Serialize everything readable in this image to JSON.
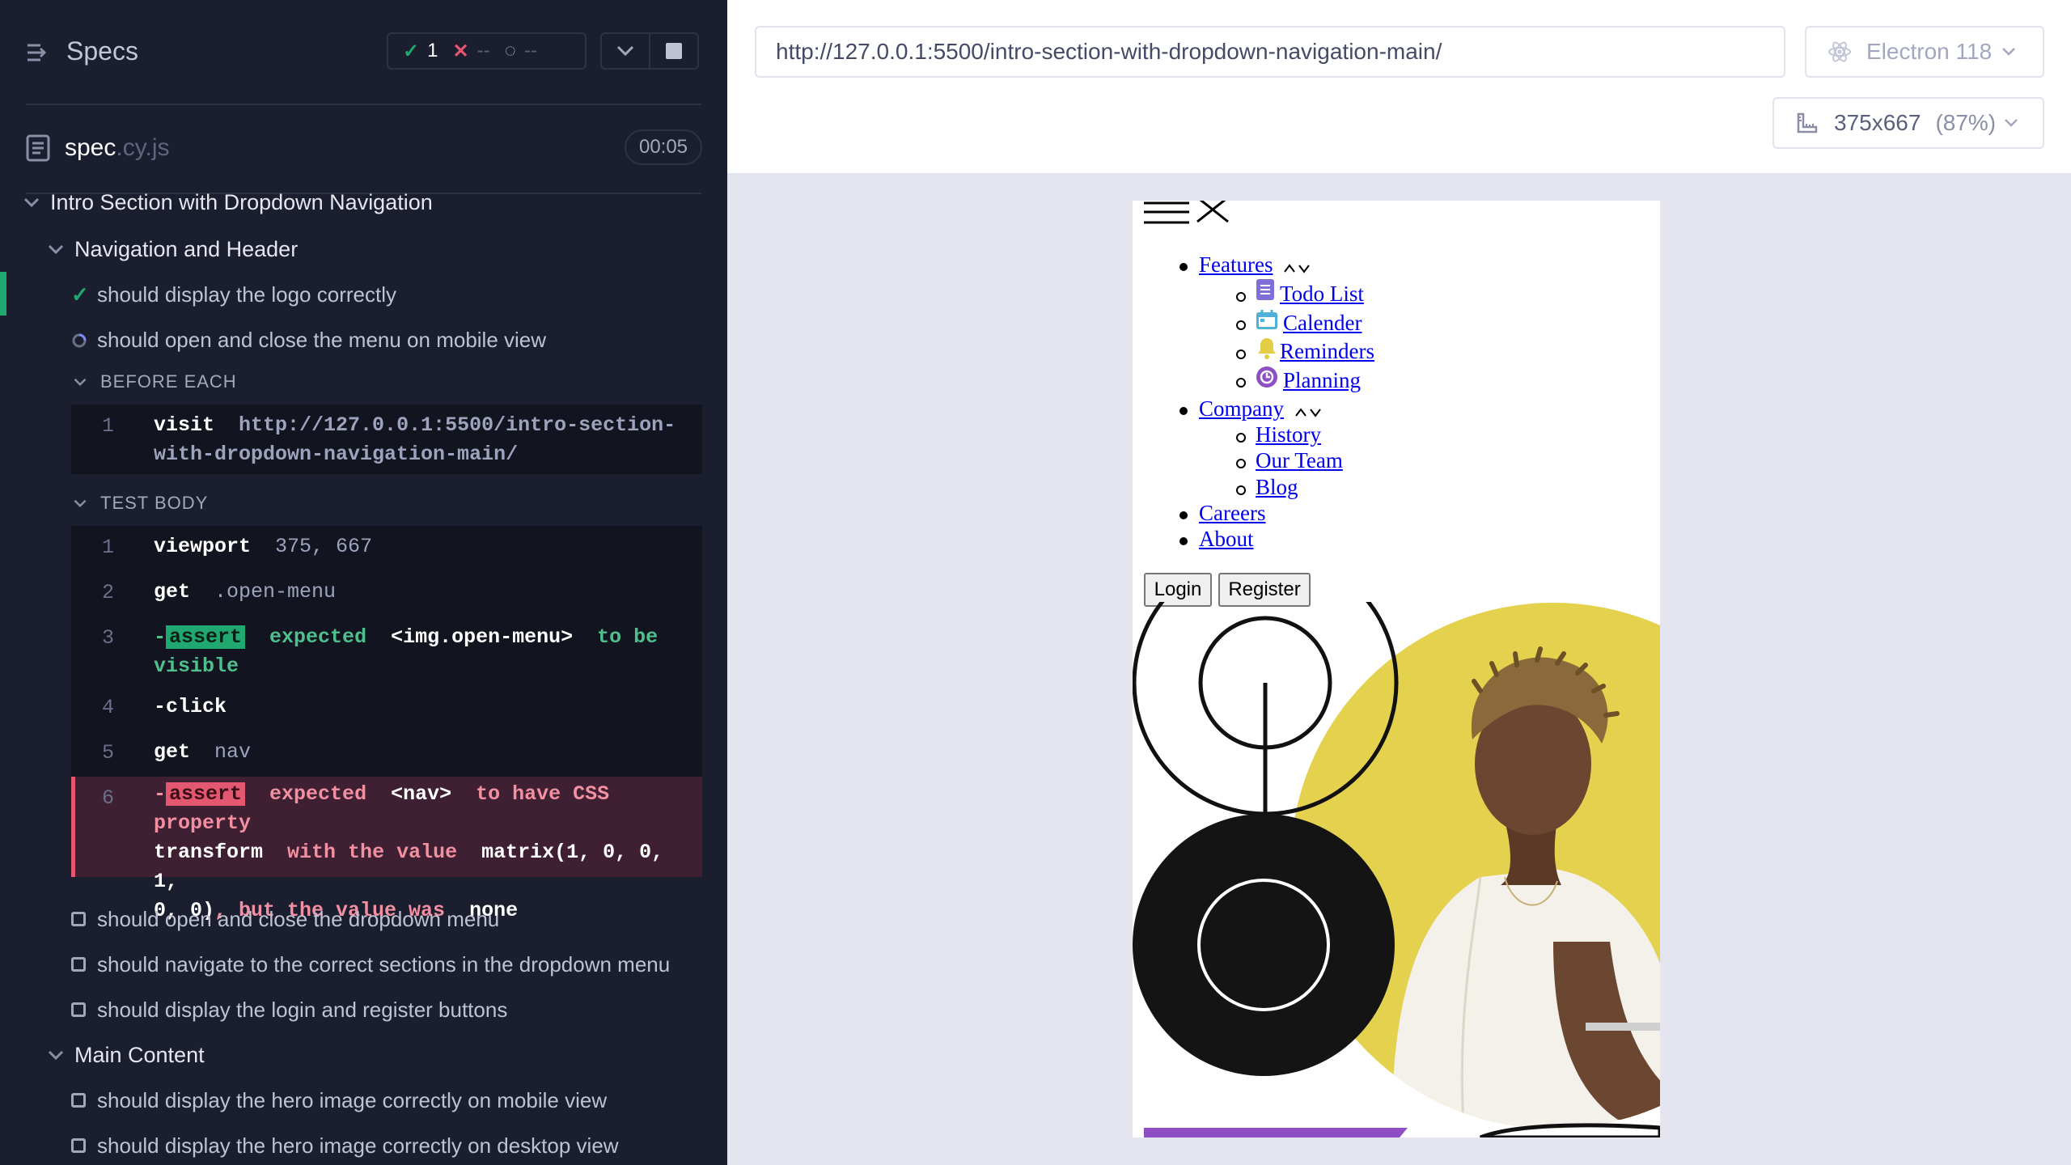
{
  "reporter": {
    "title": "Specs",
    "stats": {
      "passed": "1",
      "failed": "--",
      "pending": "--"
    },
    "spec": {
      "name": "spec",
      "ext": ".cy.js",
      "duration": "00:05"
    },
    "suite": "Intro Section with Dropdown Navigation",
    "groups": {
      "nav_header": "Navigation and Header",
      "main_content": "Main Content"
    },
    "tests": {
      "t1": "should display the logo correctly",
      "t2": "should open and close the menu on mobile view",
      "t3": "should open and close the dropdown menu",
      "t4": "should navigate to the correct sections in the dropdown menu",
      "t5": "should display the login and register buttons",
      "t6": "should display the hero image correctly on mobile view",
      "t7": "should display the hero image correctly on desktop view"
    },
    "hooks": {
      "before_each": "BEFORE EACH",
      "test_body": "TEST BODY"
    },
    "before_each_cmds": [
      {
        "n": "1",
        "name": "visit",
        "arg": "http://127.0.0.1:5500/intro-section-",
        "arg2": "with-dropdown-navigation-main/"
      }
    ],
    "body_cmds": {
      "c1": {
        "n": "1",
        "name": "viewport",
        "arg": "375, 667"
      },
      "c2": {
        "n": "2",
        "name": "get",
        "arg": ".open-menu"
      },
      "c3": {
        "n": "3",
        "dash": "-",
        "chip": "assert",
        "w1": "expected",
        "w2": "<img.open-menu>",
        "w3": "to be",
        "w4": "visible"
      },
      "c4": {
        "n": "4",
        "dash": "-",
        "name": "click"
      },
      "c5": {
        "n": "5",
        "name": "get",
        "arg": "nav"
      },
      "c6": {
        "n": "6",
        "dash": "-",
        "chip": "assert",
        "w1": "expected",
        "w2": "<nav>",
        "w3": "to have CSS property",
        "w4": "transform",
        "w5": "with the value",
        "w6": "matrix(1, 0, 0, 1,",
        "w7": "0, 0)",
        "w8": ", but the value was",
        "w9": "none"
      }
    }
  },
  "preview": {
    "url": "http://127.0.0.1:5500/intro-section-with-dropdown-navigation-main/",
    "browser": "Electron 118",
    "viewport": "375x667",
    "scale": "(87%)"
  },
  "aut": {
    "nav": {
      "features": "Features",
      "features_items": [
        "Todo List",
        "Calender",
        "Reminders",
        "Planning"
      ],
      "company": "Company",
      "company_items": [
        "History",
        "Our Team",
        "Blog"
      ],
      "careers": "Careers",
      "about": "About"
    },
    "login": "Login",
    "register": "Register"
  },
  "colors": {
    "reporter_bg": "#1b1e2e",
    "pass": "#1fa971",
    "fail": "#e45770",
    "hero_yellow": "#e2cd45",
    "accent_purple": "#8d4fc3"
  }
}
